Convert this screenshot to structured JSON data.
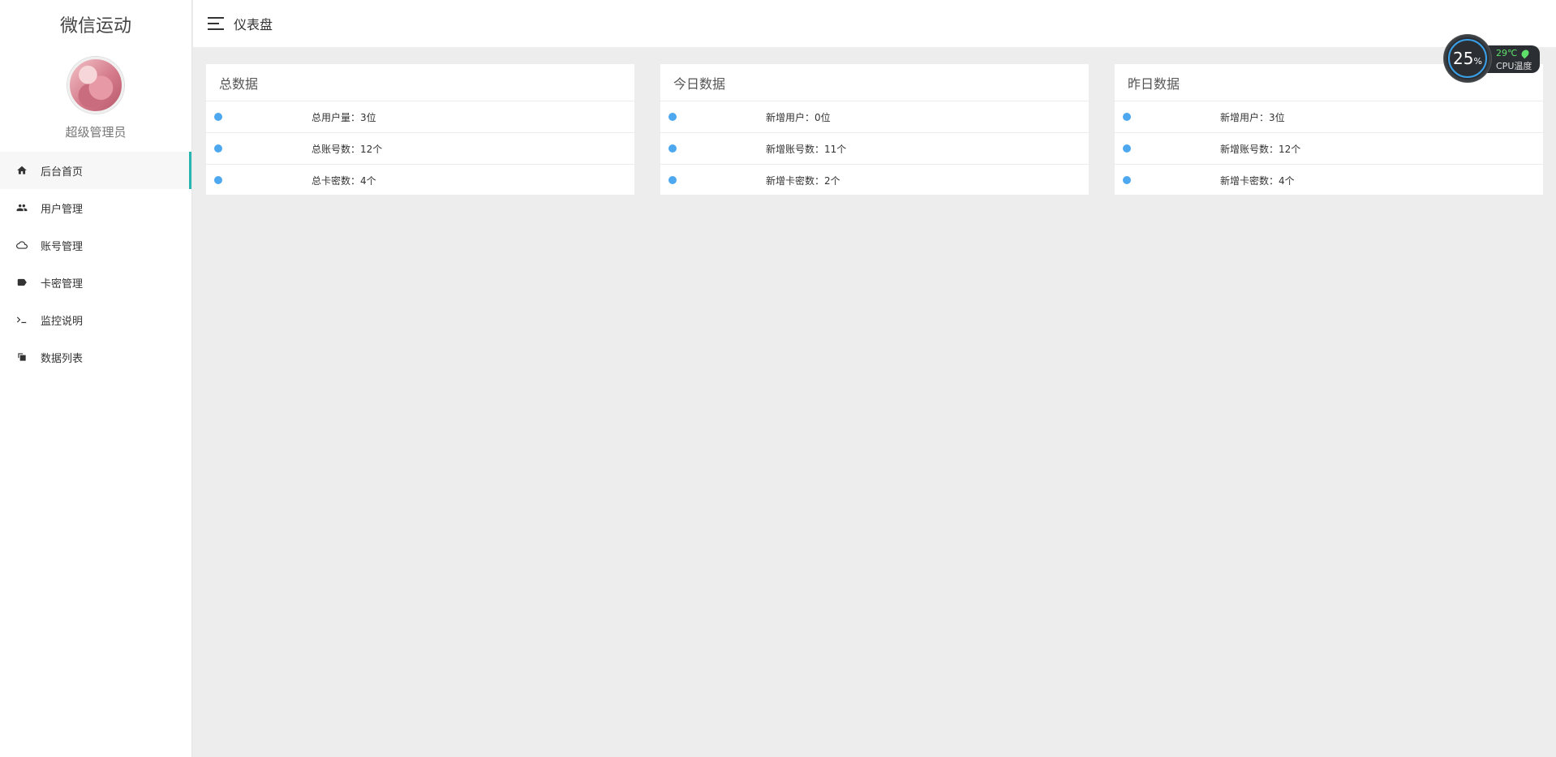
{
  "sidebar": {
    "brand": "微信运动",
    "role": "超级管理员",
    "items": [
      {
        "label": "后台首页",
        "icon": "home-icon",
        "active": true
      },
      {
        "label": "用户管理",
        "icon": "users-icon",
        "active": false
      },
      {
        "label": "账号管理",
        "icon": "cloud-icon",
        "active": false
      },
      {
        "label": "卡密管理",
        "icon": "tag-icon",
        "active": false
      },
      {
        "label": "监控说明",
        "icon": "terminal-icon",
        "active": false
      },
      {
        "label": "数据列表",
        "icon": "copy-icon",
        "active": false
      }
    ]
  },
  "header": {
    "menu_icon": "hamburger-icon",
    "title": "仪表盘"
  },
  "cards": [
    {
      "title": "总数据",
      "rows": [
        "总用户量：3位",
        "总账号数：12个",
        "总卡密数：4个"
      ]
    },
    {
      "title": "今日数据",
      "rows": [
        "新增用户：0位",
        "新增账号数：11个",
        "新增卡密数：2个"
      ]
    },
    {
      "title": "昨日数据",
      "rows": [
        "新增用户：3位",
        "新增账号数：12个",
        "新增卡密数：4个"
      ]
    }
  ],
  "cpu_widget": {
    "usage_value": "25",
    "usage_unit": "%",
    "temperature": "29℃",
    "label": "CPU温度"
  },
  "colors": {
    "accent": "#26b5b0",
    "dot": "#4ea8f0",
    "temperature": "#5ee06a"
  }
}
